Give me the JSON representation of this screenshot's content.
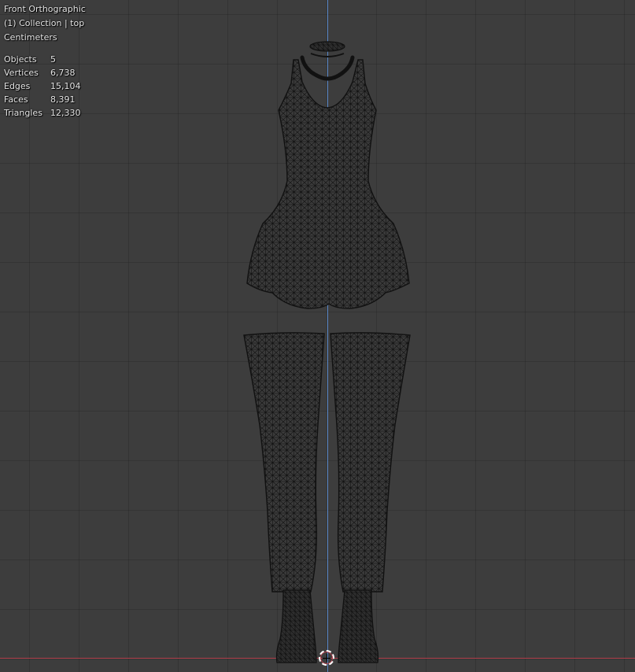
{
  "viewport": {
    "view_name": "Front Orthographic",
    "collection": "(1) Collection | top",
    "units": "Centimeters",
    "background_color": "#3d3d3d",
    "axis_x_color": "#b2404c",
    "axis_y_color": "#5a88c9",
    "mesh_color": "#111111"
  },
  "stats": [
    {
      "label": "Objects",
      "value": "5"
    },
    {
      "label": "Vertices",
      "value": "6,738"
    },
    {
      "label": "Edges",
      "value": "15,104"
    },
    {
      "label": "Faces",
      "value": "8,391"
    },
    {
      "label": "Triangles",
      "value": "12,330"
    }
  ],
  "scene_objects": [
    "choker",
    "bodysuit",
    "left-stocking",
    "right-stocking",
    "left-boot",
    "right-boot"
  ],
  "icons": {
    "cursor": "3d-cursor-icon"
  }
}
